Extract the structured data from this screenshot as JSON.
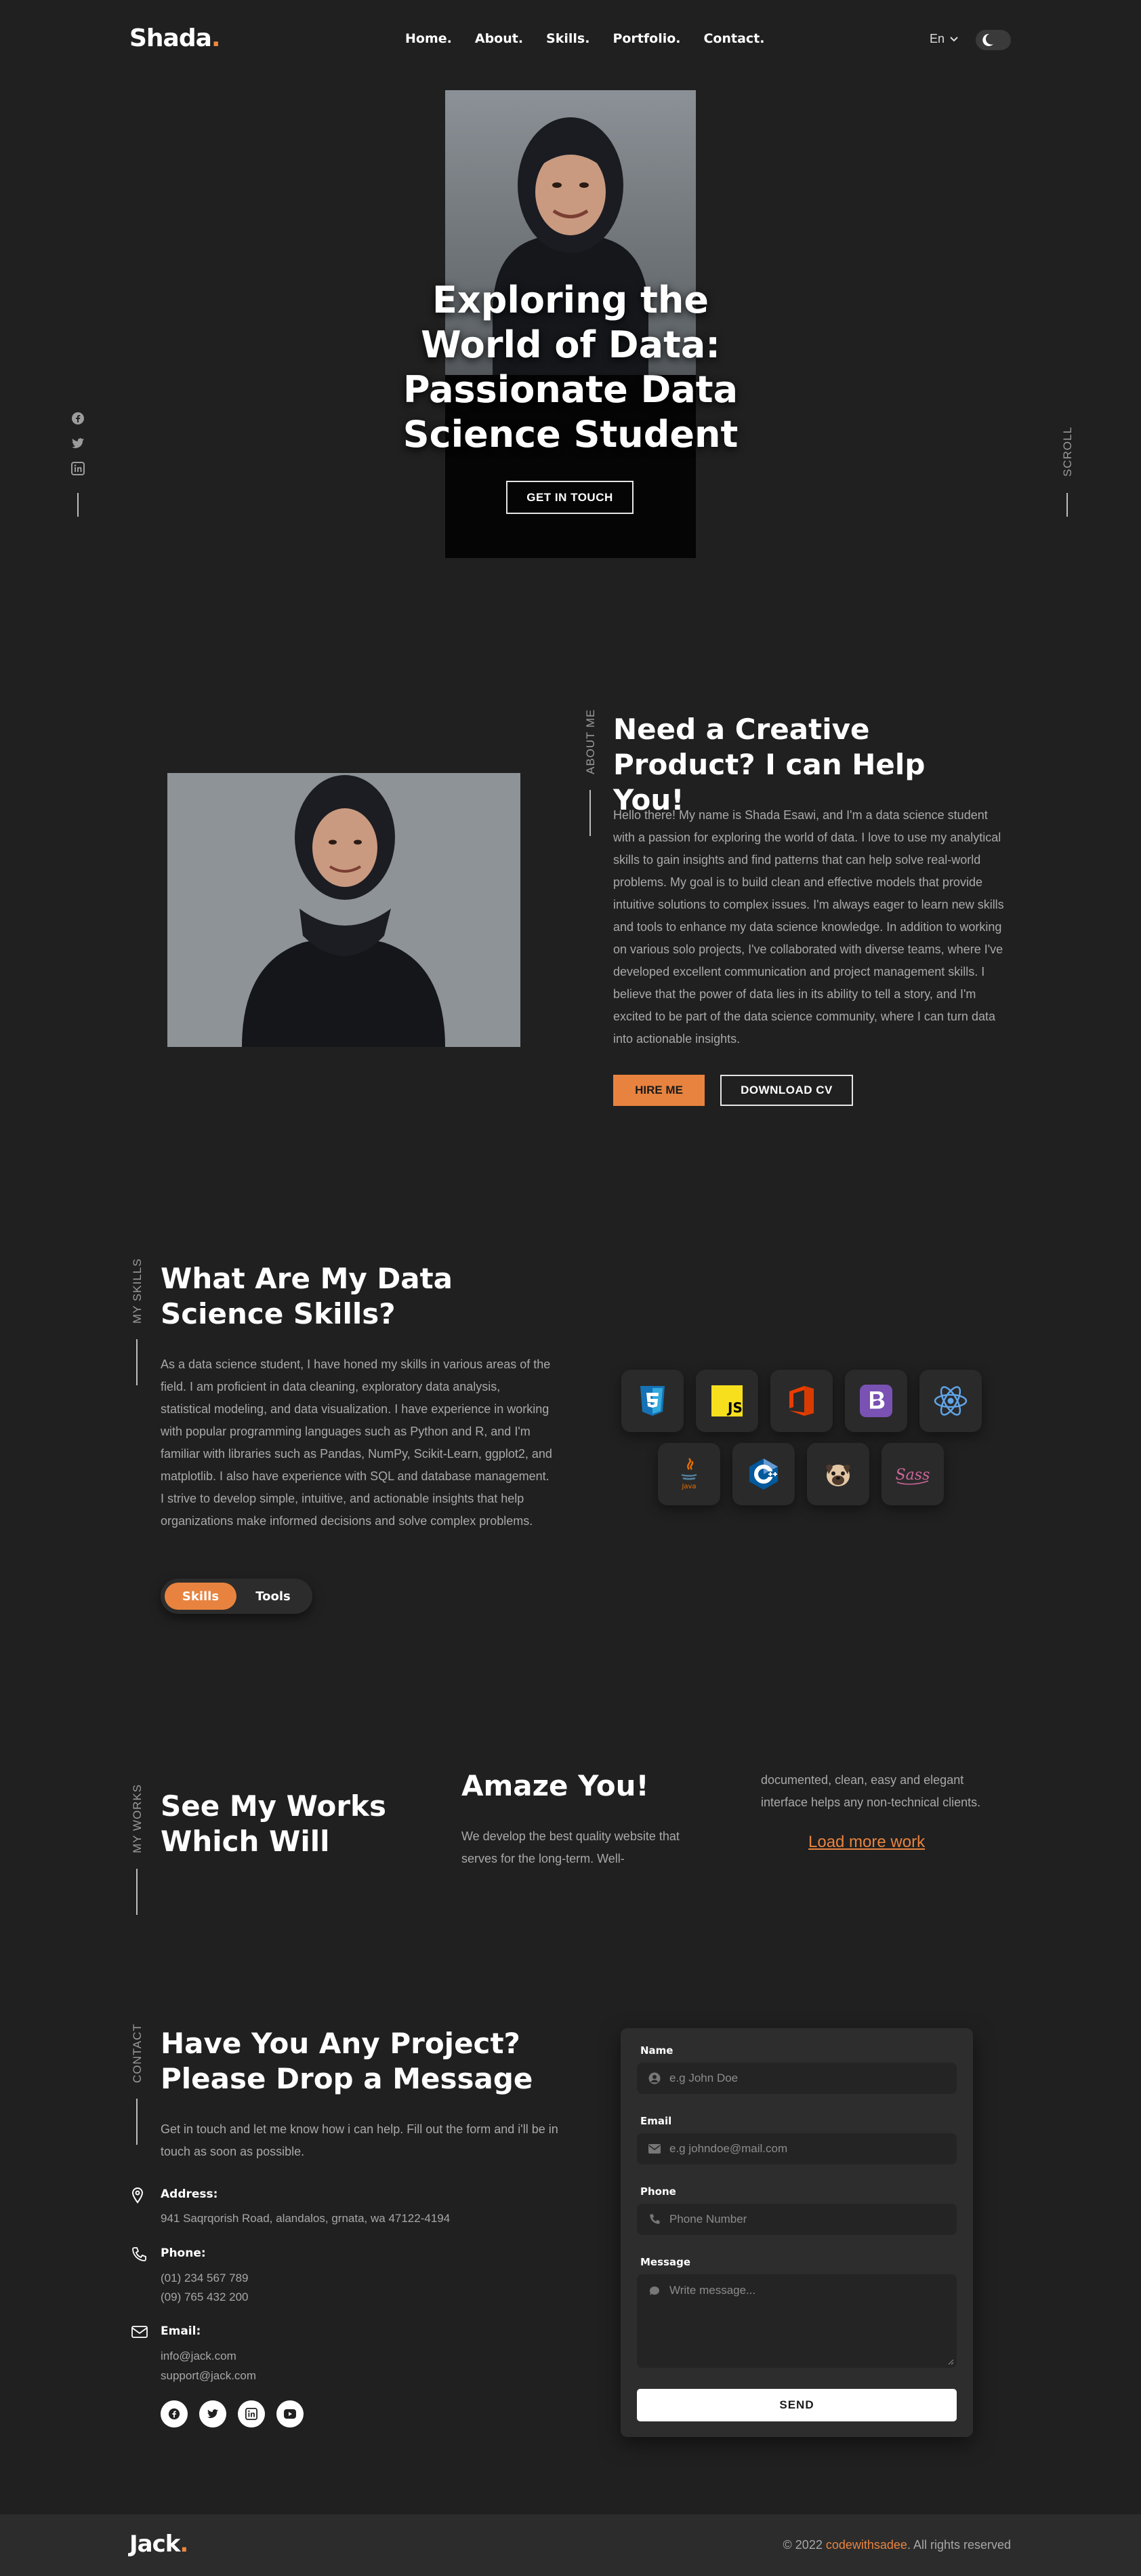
{
  "nav": {
    "logo": "Shada",
    "logo_dot": ".",
    "links": [
      "Home.",
      "About.",
      "Skills.",
      "Portfolio.",
      "Contact."
    ],
    "language": "En"
  },
  "hero": {
    "title_lines": [
      "Exploring the",
      "World of Data:",
      "Passionate Data",
      "Science Student"
    ],
    "cta": "GET IN TOUCH",
    "scroll": "SCROLL"
  },
  "about": {
    "label": "ABOUT ME",
    "title_lines": [
      "Need a Creative",
      "Product? I can Help You!"
    ],
    "body": "Hello there! My name is Shada Esawi, and I'm a data science student with a passion for exploring the world of data. I love to use my analytical skills to gain insights and find patterns that can help solve real-world problems. My goal is to build clean and effective models that provide intuitive solutions to complex issues. I'm always eager to learn new skills and tools to enhance my data science knowledge. In addition to working on various solo projects, I've collaborated with diverse teams, where I've developed excellent communication and project management skills. I believe that the power of data lies in its ability to tell a story, and I'm excited to be part of the data science community, where I can turn data into actionable insights.",
    "hire_button": "HIRE ME",
    "cv_button": "DOWNLOAD CV"
  },
  "skills": {
    "label": "MY SKILLS",
    "title_lines": [
      "What Are My Data",
      "Science Skills?"
    ],
    "body": "As a data science student, I have honed my skills in various areas of the field. I am proficient in data cleaning, exploratory data analysis, statistical modeling, and data visualization. I have experience in working with popular programming languages such as Python and R, and I'm familiar with libraries such as Pandas, NumPy, Scikit-Learn, ggplot2, and matplotlib. I also have experience with SQL and database management. I strive to develop simple, intuitive, and actionable insights that help organizations make informed decisions and solve complex problems.",
    "tabs": [
      "Skills",
      "Tools"
    ],
    "icons_row1": [
      "css3-icon",
      "javascript-icon",
      "office-icon",
      "bootstrap-icon",
      "react-icon"
    ],
    "icons_row2": [
      "java-icon",
      "cplusplus-icon",
      "pug-icon",
      "sass-icon"
    ],
    "icon_text": {
      "js": "JS",
      "java": "Java",
      "sass": "Sass"
    }
  },
  "works": {
    "label": "MY WORKS",
    "title_lines": [
      "See My Works",
      "Which Will"
    ],
    "amaze": "Amaze You!",
    "desc_left": "We develop the best quality website that serves for the long-term. Well-",
    "desc_right": "documented, clean, easy and elegant interface helps any non-technical clients.",
    "load_more": "Load more work"
  },
  "contact": {
    "label": "CONTACT",
    "title_lines": [
      "Have You Any Project?",
      "Please Drop a Message"
    ],
    "intro": "Get in touch and let me know how i can help. Fill out the form and i'll be in touch as soon as possible.",
    "address_label": "Address:",
    "address": "941 Saqrqorish Road, alandalos, grnata, wa 47122-4194",
    "phone_label": "Phone:",
    "phones": [
      "(01) 234 567 789",
      "(09) 765 432 200"
    ],
    "email_label": "Email:",
    "emails": [
      "info@jack.com",
      "support@jack.com"
    ],
    "form": {
      "name_label": "Name",
      "name_placeholder": "e.g John Doe",
      "email_label": "Email",
      "email_placeholder": "e.g johndoe@mail.com",
      "phone_label": "Phone",
      "phone_placeholder": "Phone Number",
      "message_label": "Message",
      "message_placeholder": "Write message...",
      "send": "SEND"
    }
  },
  "footer": {
    "logo": "Jack",
    "logo_dot": ".",
    "copy_prefix": "© 2022 ",
    "copy_link": "codewithsadee",
    "copy_suffix": ". All rights reserved"
  },
  "colors": {
    "accent": "#e8833f",
    "background": "#202020",
    "card": "#2d2d2d"
  }
}
